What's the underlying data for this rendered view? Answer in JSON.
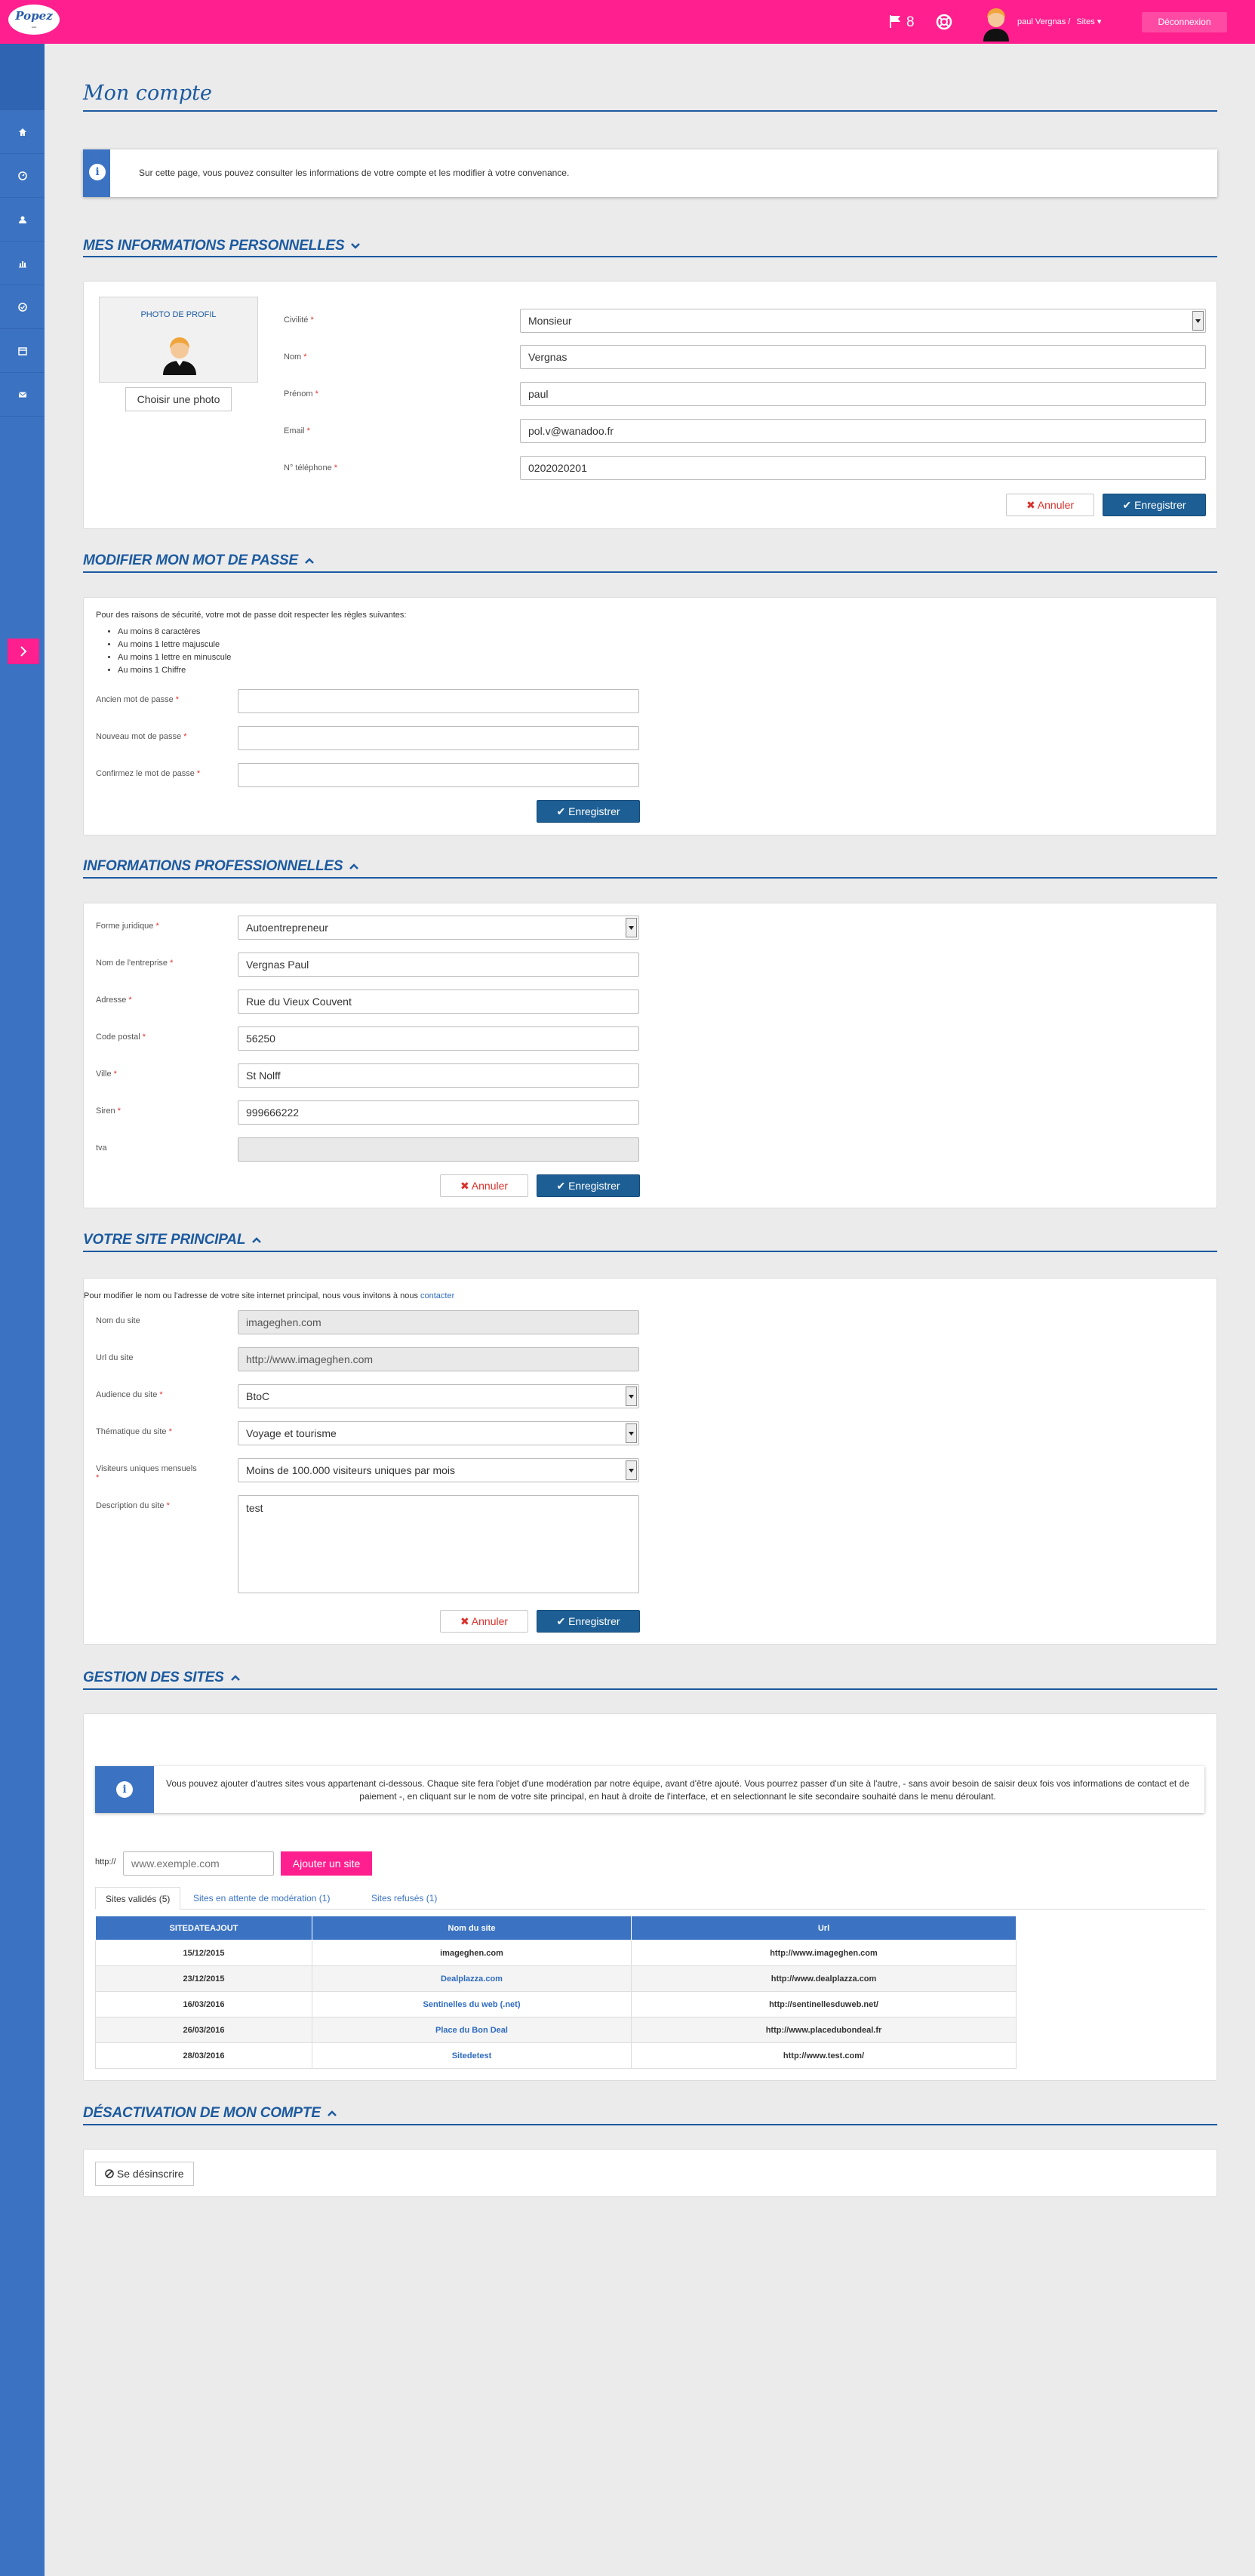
{
  "topbar": {
    "logo_text": "Popez",
    "logo_sub": "—",
    "flag_count": "8",
    "user_name": "paul Vergnas /",
    "sites_menu": "Sites",
    "logout_label": "Déconnexion"
  },
  "page_title": "Mon compte",
  "intro_text": "Sur cette page, vous pouvez consulter les informations de votre compte et les modifier à votre convenance.",
  "personal": {
    "title": "MES INFORMATIONS PERSONNELLES",
    "photo_label": "PHOTO DE PROFIL",
    "photo_button": "Choisir une photo",
    "fields": {
      "civilite": {
        "label": "Civilité",
        "value": "Monsieur"
      },
      "nom": {
        "label": "Nom",
        "value": "Vergnas"
      },
      "prenom": {
        "label": "Prénom",
        "value": "paul"
      },
      "email": {
        "label": "Email",
        "value": "pol.v@wanadoo.fr"
      },
      "tel": {
        "label": "N° téléphone",
        "value": "0202020201"
      }
    },
    "cancel": "Annuler",
    "save": "Enregistrer"
  },
  "password": {
    "title": "MODIFIER MON MOT DE PASSE",
    "intro": "Pour des raisons de sécurité, votre mot de passe doit respecter les règles suivantes:",
    "rules": [
      "Au moins 8 caractères",
      "Au moins 1 lettre majuscule",
      "Au moins 1 lettre en minuscule",
      "Au moins 1 Chiffre"
    ],
    "old_label": "Ancien mot de passe",
    "new_label": "Nouveau mot de passe",
    "confirm_label": "Confirmez le mot de passe",
    "save": "Enregistrer"
  },
  "pro": {
    "title": "INFORMATIONS PROFESSIONNELLES",
    "fields": {
      "forme": {
        "label": "Forme juridique",
        "value": "Autoentrepreneur"
      },
      "entreprise": {
        "label": "Nom de l'entreprise",
        "value": "Vergnas Paul"
      },
      "adresse": {
        "label": "Adresse",
        "value": "Rue du Vieux Couvent"
      },
      "cp": {
        "label": "Code postal",
        "value": "56250"
      },
      "ville": {
        "label": "Ville",
        "value": "St Nolff"
      },
      "siren": {
        "label": "Siren",
        "value": "999666222"
      },
      "tva": {
        "label": "tva",
        "value": ""
      }
    },
    "cancel": "Annuler",
    "save": "Enregistrer"
  },
  "site": {
    "title": "VOTRE SITE PRINCIPAL",
    "intro": "Pour modifier le nom ou l'adresse de votre site internet principal, nous vous invitons à nous",
    "contact_link": "contacter",
    "fields": {
      "nom": {
        "label": "Nom du site",
        "value": "imageghen.com"
      },
      "url": {
        "label": "Url du site",
        "value": "http://www.imageghen.com"
      },
      "audience": {
        "label": "Audience du site",
        "value": "BtoC"
      },
      "thematique": {
        "label": "Thématique du site",
        "value": "Voyage et tourisme"
      },
      "visiteurs": {
        "label": "Visiteurs uniques mensuels",
        "value": "Moins de 100.000 visiteurs uniques par mois"
      },
      "description": {
        "label": "Description du site",
        "value": "test"
      }
    },
    "cancel": "Annuler",
    "save": "Enregistrer"
  },
  "gestion": {
    "title": "GESTION DES SITES",
    "info": "Vous pouvez ajouter d'autres sites vous appartenant ci-dessous. Chaque site fera l'objet d'une modération par notre équipe, avant d'être ajouté. Vous pourrez passer d'un site à l'autre, - sans avoir besoin de saisir deux fois vos informations de contact et de paiement -, en cliquant sur le nom de votre site principal, en haut à droite de l'interface, et en selectionnant le site secondaire souhaité dans le menu déroulant.",
    "http_prefix": "http://",
    "placeholder": "www.exemple.com",
    "add_button": "Ajouter un site",
    "tabs": [
      "Sites validés (5)",
      "Sites en attente de modération (1)",
      "Sites refusés (1)"
    ],
    "columns": [
      "SITEDATEAJOUT",
      "Nom du site",
      "Url"
    ],
    "rows": [
      [
        "15/12/2015",
        "imageghen.com",
        "http://www.imageghen.com"
      ],
      [
        "23/12/2015",
        "Dealplazza.com",
        "http://www.dealplazza.com"
      ],
      [
        "16/03/2016",
        "Sentinelles du web (.net)",
        "http://sentinellesduweb.net/"
      ],
      [
        "26/03/2016",
        "Place du Bon Deal",
        "http://www.placedubondeal.fr"
      ],
      [
        "28/03/2016",
        "Sitedetest",
        "http://www.test.com/"
      ]
    ]
  },
  "deactivation": {
    "title": "DÉSACTIVATION DE MON COMPTE",
    "button": "Se désinscrire"
  }
}
